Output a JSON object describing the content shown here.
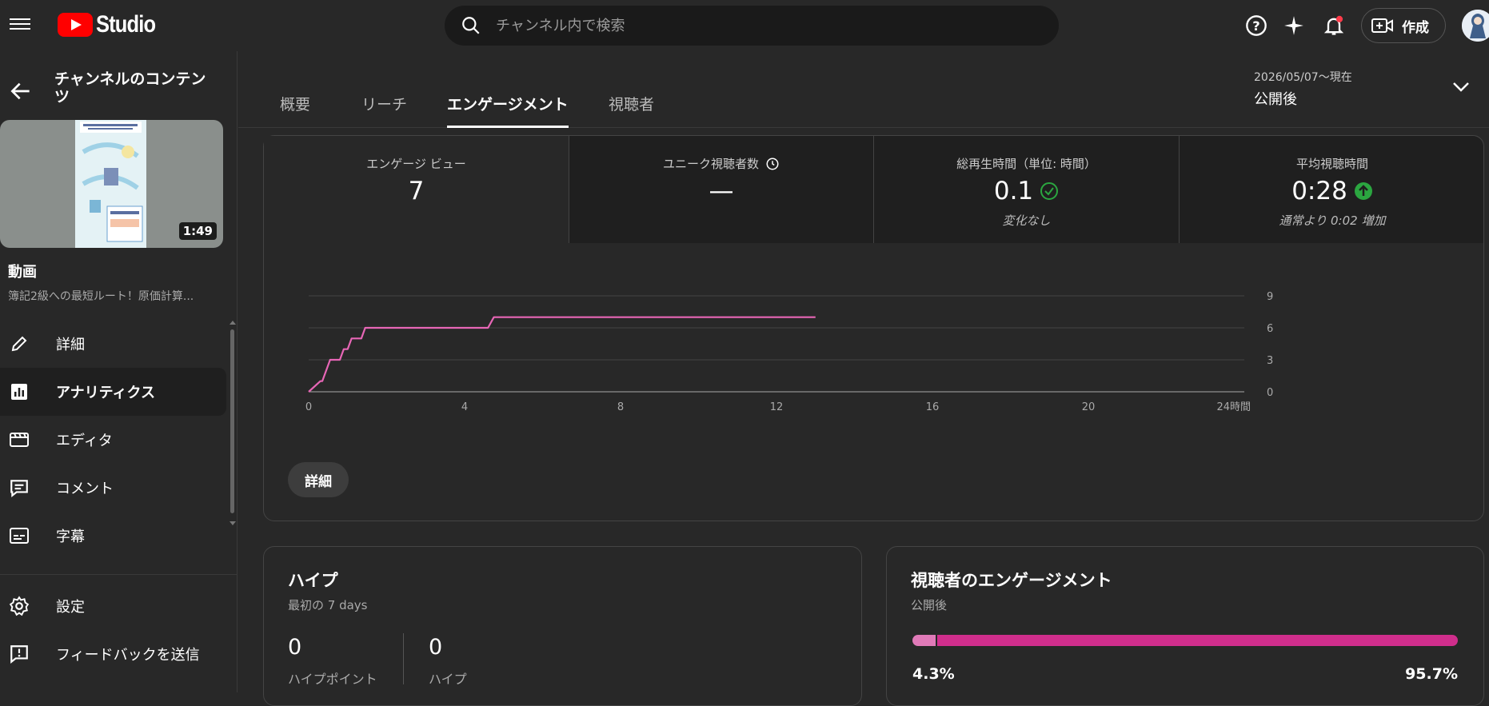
{
  "header": {
    "logo_text": "Studio",
    "search_placeholder": "チャンネル内で検索",
    "create_label": "作成"
  },
  "sidebar": {
    "title": "チャンネルのコンテンツ",
    "duration": "1:49",
    "video_label": "動画",
    "video_title": "簿記2級への最短ルート！原価計算...",
    "items": [
      {
        "label": "詳細",
        "icon": "pencil-icon"
      },
      {
        "label": "アナリティクス",
        "icon": "analytics-icon",
        "active": true
      },
      {
        "label": "エディタ",
        "icon": "editor-icon"
      },
      {
        "label": "コメント",
        "icon": "comment-icon"
      },
      {
        "label": "字幕",
        "icon": "subtitles-icon"
      }
    ],
    "bottom_items": [
      {
        "label": "設定",
        "icon": "gear-icon"
      },
      {
        "label": "フィードバックを送信",
        "icon": "feedback-icon"
      }
    ]
  },
  "tabs": [
    {
      "label": "概要"
    },
    {
      "label": "リーチ"
    },
    {
      "label": "エンゲージメント",
      "active": true
    },
    {
      "label": "視聴者"
    }
  ],
  "date_selector": {
    "range": "2026/05/07〜現在",
    "label": "公開後"
  },
  "metrics": [
    {
      "label": "エンゲージ ビュー",
      "value": "7",
      "sub": ""
    },
    {
      "label": "ユニーク視聴者数",
      "value": "—",
      "sub": ""
    },
    {
      "label": "総再生時間（単位: 時間）",
      "value": "0.1",
      "sub": "変化なし"
    },
    {
      "label": "平均視聴時間",
      "value": "0:28",
      "sub": "通常より 0:02 増加"
    }
  ],
  "details_button": "詳細",
  "chart_data": {
    "type": "line",
    "x_ticks": [
      "0",
      "4",
      "8",
      "12",
      "16",
      "20",
      "24時間"
    ],
    "y_ticks": [
      "0",
      "3",
      "6",
      "9"
    ],
    "xlim": [
      0,
      24
    ],
    "ylim": [
      0,
      9
    ],
    "color": "#e766b6",
    "series": [
      {
        "points": [
          [
            0,
            0
          ],
          [
            0.3,
            1
          ],
          [
            0.35,
            1
          ],
          [
            0.55,
            3
          ],
          [
            0.8,
            3
          ],
          [
            0.9,
            4
          ],
          [
            1.0,
            4
          ],
          [
            1.1,
            5
          ],
          [
            1.35,
            5
          ],
          [
            1.45,
            6
          ],
          [
            4.6,
            6
          ],
          [
            4.75,
            7
          ],
          [
            13.0,
            7
          ]
        ]
      }
    ]
  },
  "hype": {
    "title": "ハイプ",
    "subtitle": "最初の 7 days",
    "points_value": "0",
    "points_label": "ハイプポイント",
    "hype_value": "0",
    "hype_label": "ハイプ"
  },
  "audience_engagement": {
    "title": "視聴者のエンゲージメント",
    "subtitle": "公開後",
    "left_pct": "4.3%",
    "right_pct": "95.7%",
    "left_fraction": 0.043,
    "left_color": "#e07ab8",
    "right_color": "#d02e8c"
  }
}
